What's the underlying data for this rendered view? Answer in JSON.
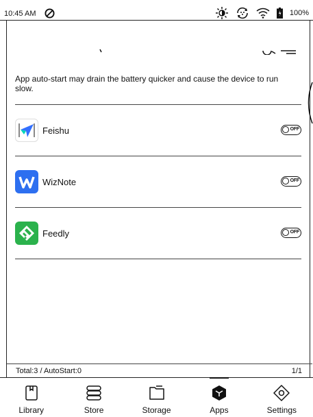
{
  "status_bar": {
    "time": "10:45 AM",
    "battery": "100%",
    "icons": [
      "do-not-disturb-icon",
      "brightness-icon",
      "refresh-icon",
      "wifi-icon",
      "battery-icon"
    ]
  },
  "page": {
    "description": "App auto-start may drain the battery quicker and cause the device to run slow."
  },
  "apps": [
    {
      "name": "Feishu",
      "icon": "feishu-icon",
      "toggle": "OFF",
      "color": "#3370ff"
    },
    {
      "name": "WizNote",
      "icon": "wiznote-icon",
      "toggle": "OFF",
      "color": "#2d6ff0"
    },
    {
      "name": "Feedly",
      "icon": "feedly-icon",
      "toggle": "OFF",
      "color": "#2bb24c"
    }
  ],
  "footer": {
    "total": "Total:3 / AutoStart:0",
    "page": "1/1"
  },
  "nav": [
    {
      "label": "Library",
      "icon": "library-icon"
    },
    {
      "label": "Store",
      "icon": "store-icon"
    },
    {
      "label": "Storage",
      "icon": "storage-icon"
    },
    {
      "label": "Apps",
      "icon": "apps-icon",
      "active": true
    },
    {
      "label": "Settings",
      "icon": "settings-icon"
    }
  ]
}
